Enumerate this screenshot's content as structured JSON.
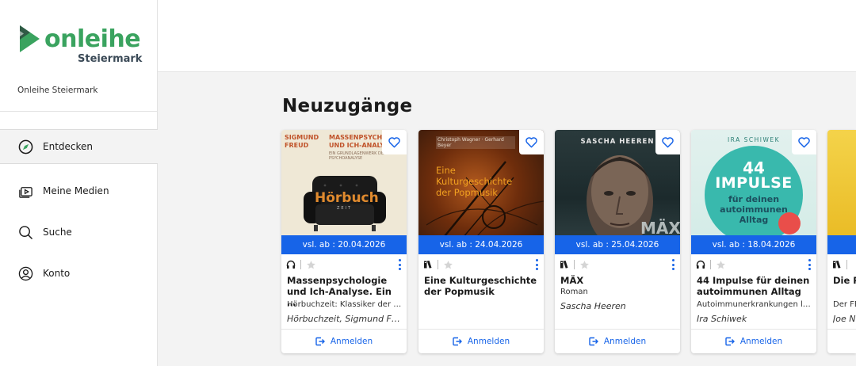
{
  "sidebar": {
    "logo_text": "onleihe",
    "logo_region": "Steiermark",
    "library_name": "Onleihe Steiermark",
    "nav": [
      {
        "label": "Entdecken",
        "icon": "compass-icon",
        "active": true
      },
      {
        "label": "Meine Medien",
        "icon": "media-library-icon"
      },
      {
        "label": "Suche",
        "icon": "search-icon"
      },
      {
        "label": "Konto",
        "icon": "account-icon"
      }
    ]
  },
  "section": {
    "title": "Neuzugänge"
  },
  "cards": [
    {
      "availability": "vsl. ab : 20.04.2026",
      "media_icon": "headphones-icon",
      "title": "Massenpsychologie und Ich-Analyse. Ein …",
      "subtitle": "Hörbuchzeit: Klassiker der We...",
      "author": "Hörbuchzeit, Sigmund Freud",
      "login_label": "Anmelden",
      "cover": {
        "author_text": "SIGMUND FREUD",
        "title_text": "MASSENPSYCHOLOGIE UND ICH-ANALYSE",
        "line_text": "EIN GRUNDLAGENWERK DER PSYCHOANALYSE",
        "brand_text": "Hörbuch",
        "brand_sub": "ZEIT"
      }
    },
    {
      "availability": "vsl. ab : 24.04.2026",
      "media_icon": "book-icon",
      "title": "Eine Kulturgeschichte der Popmusik",
      "subtitle": "",
      "author": "",
      "login_label": "Anmelden",
      "cover": {
        "author_text": "Christoph Wagner · Gerhard Beyer",
        "title_text": "Eine Kulturgeschichte der Popmusik"
      }
    },
    {
      "availability": "vsl. ab : 25.04.2026",
      "media_icon": "book-icon",
      "title": "MÄX",
      "subtitle": "Roman",
      "author": "Sascha Heeren",
      "login_label": "Anmelden",
      "cover": {
        "author_text": "SASCHA HEEREN",
        "title_text": "MÄX"
      }
    },
    {
      "availability": "vsl. ab : 18.04.2026",
      "media_icon": "headphones-icon",
      "title": "44 Impulse für deinen autoimmunen Alltag",
      "subtitle": "Autoimmunerkrankungen lang...",
      "author": "Ira Schiwek",
      "login_label": "Anmelden",
      "cover": {
        "author_text": "IRA SCHIWEK",
        "big_text": "44",
        "title_text": "IMPULSE",
        "line1": "für deinen",
        "line2": "autoimmunen",
        "line3": "Alltag"
      }
    },
    {
      "availability": "",
      "media_icon": "book-icon",
      "title": "Die P… uns",
      "subtitle": "Der FE…",
      "author": "Joe N…",
      "login_label": "",
      "cover": {}
    }
  ],
  "colors": {
    "brand_green": "#3aa35f",
    "accent_blue": "#1764e8"
  }
}
